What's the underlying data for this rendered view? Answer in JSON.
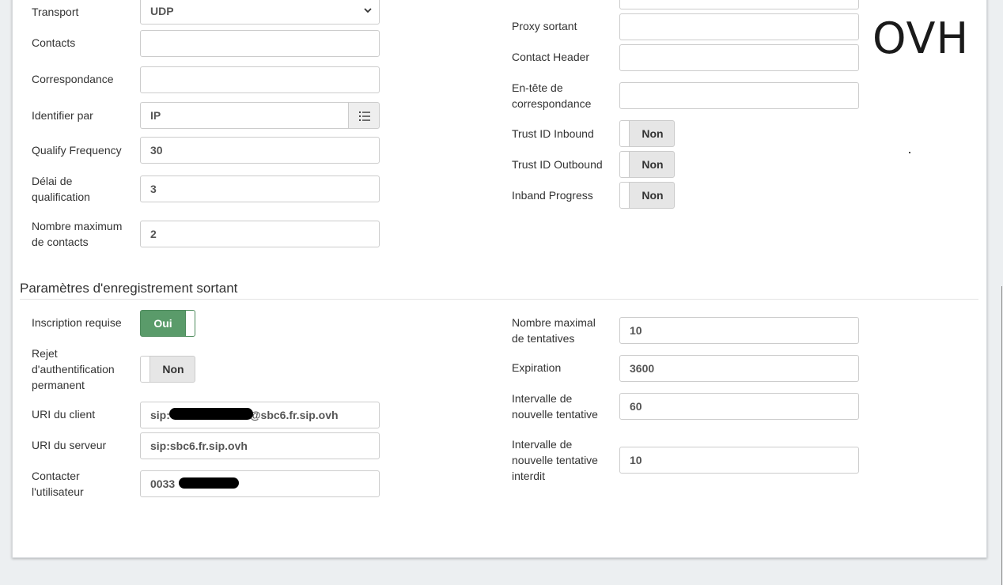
{
  "annotation": {
    "logo_text": "OVH"
  },
  "left_fields": {
    "transport": {
      "label": "Transport",
      "value": "UDP"
    },
    "contacts": {
      "label": "Contacts",
      "value": ""
    },
    "correspondance": {
      "label": "Correspondance",
      "value": ""
    },
    "identify_by": {
      "label": "Identifier par",
      "value": "IP",
      "icon": "list-icon"
    },
    "qualify_frequency": {
      "label": "Qualify Frequency",
      "value": "30"
    },
    "qualify_delay": {
      "label_line1": "Délai de",
      "label_line2": "qualification",
      "value": "3"
    },
    "max_contacts": {
      "label_line1": "Nombre maximum",
      "label_line2": "de contacts",
      "value": "2"
    }
  },
  "right_fields": {
    "outbound_proxy": {
      "label": "Proxy sortant",
      "value": ""
    },
    "contact_header": {
      "label": "Contact Header",
      "value": ""
    },
    "match_header": {
      "label_line1": "En-tête de",
      "label_line2": "correspondance",
      "value": ""
    },
    "trust_id_inbound": {
      "label": "Trust ID Inbound",
      "state": "Non"
    },
    "trust_id_outbound": {
      "label": "Trust ID Outbound",
      "state": "Non"
    },
    "inband_progress": {
      "label": "Inband Progress",
      "state": "Non"
    }
  },
  "outbound_registration": {
    "title": "Paramètres d'enregistrement sortant",
    "registration_required": {
      "label": "Inscription requise",
      "state": "Oui"
    },
    "permanent_auth_reject": {
      "label_line1": "Rejet",
      "label_line2": "d'authentification",
      "label_line3": "permanent",
      "state": "Non"
    },
    "client_uri": {
      "label": "URI du client",
      "value_prefix": "sip:",
      "value_suffix": "@sbc6.fr.sip.ovh"
    },
    "server_uri": {
      "label": "URI du serveur",
      "value": "sip:sbc6.fr.sip.ovh"
    },
    "contact_user": {
      "label_line1": "Contacter",
      "label_line2": "l'utilisateur",
      "value_prefix": "0033"
    },
    "max_retries": {
      "label_line1": "Nombre maximal",
      "label_line2": "de tentatives",
      "value": "10"
    },
    "expiration": {
      "label": "Expiration",
      "value": "3600"
    },
    "retry_interval": {
      "label_line1": "Intervalle de",
      "label_line2": "nouvelle tentative",
      "value": "60"
    },
    "forbidden_retry_interval": {
      "label_line1": "Intervalle de",
      "label_line2": "nouvelle tentative",
      "label_line3": "interdit",
      "value": "10"
    }
  }
}
